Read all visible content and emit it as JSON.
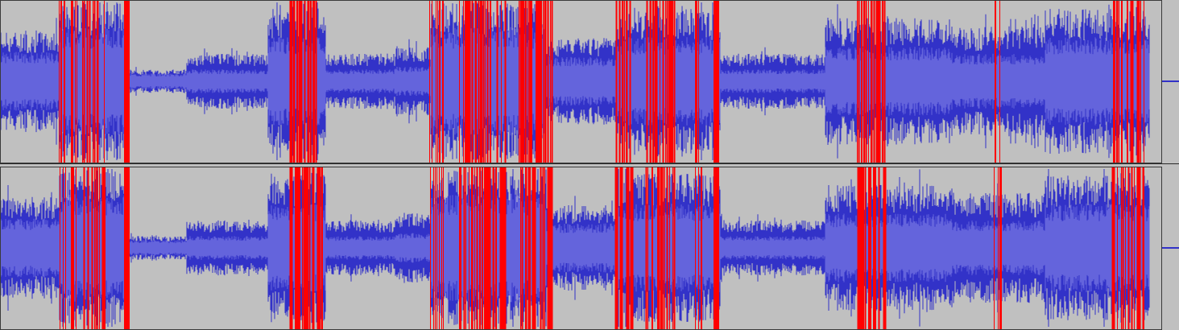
{
  "colors": {
    "background": "#c0c0c0",
    "wave_outer": "#3232c8",
    "wave_rms": "#6464dc",
    "clipping": "#ff0000",
    "border": "#3a3a3a"
  },
  "audio": {
    "channels": [
      "left",
      "right"
    ],
    "envelope_segments": [
      {
        "start": 0.0,
        "end": 0.05,
        "peak": 0.65,
        "rms": 0.3
      },
      {
        "start": 0.05,
        "end": 0.11,
        "peak": 1.0,
        "rms": 0.55
      },
      {
        "start": 0.11,
        "end": 0.16,
        "peak": 0.15,
        "rms": 0.08
      },
      {
        "start": 0.16,
        "end": 0.23,
        "peak": 0.35,
        "rms": 0.12
      },
      {
        "start": 0.23,
        "end": 0.28,
        "peak": 0.95,
        "rms": 0.45
      },
      {
        "start": 0.28,
        "end": 0.34,
        "peak": 0.35,
        "rms": 0.12
      },
      {
        "start": 0.34,
        "end": 0.37,
        "peak": 0.45,
        "rms": 0.15
      },
      {
        "start": 0.37,
        "end": 0.47,
        "peak": 1.0,
        "rms": 0.55
      },
      {
        "start": 0.47,
        "end": 0.53,
        "peak": 0.55,
        "rms": 0.25
      },
      {
        "start": 0.53,
        "end": 0.62,
        "peak": 0.95,
        "rms": 0.45
      },
      {
        "start": 0.62,
        "end": 0.71,
        "peak": 0.35,
        "rms": 0.12
      },
      {
        "start": 0.71,
        "end": 0.82,
        "peak": 0.8,
        "rms": 0.35
      },
      {
        "start": 0.82,
        "end": 0.9,
        "peak": 0.7,
        "rms": 0.28
      },
      {
        "start": 0.9,
        "end": 0.99,
        "peak": 0.92,
        "rms": 0.45
      }
    ],
    "clipping_ranges": [
      [
        0.05,
        0.056
      ],
      [
        0.06,
        0.065
      ],
      [
        0.07,
        0.09
      ],
      [
        0.106,
        0.11
      ],
      [
        0.248,
        0.278
      ],
      [
        0.368,
        0.382
      ],
      [
        0.395,
        0.436
      ],
      [
        0.446,
        0.475
      ],
      [
        0.528,
        0.546
      ],
      [
        0.556,
        0.58
      ],
      [
        0.597,
        0.604
      ],
      [
        0.614,
        0.618
      ],
      [
        0.738,
        0.762
      ],
      [
        0.856,
        0.862
      ],
      [
        0.958,
        0.985
      ]
    ]
  }
}
